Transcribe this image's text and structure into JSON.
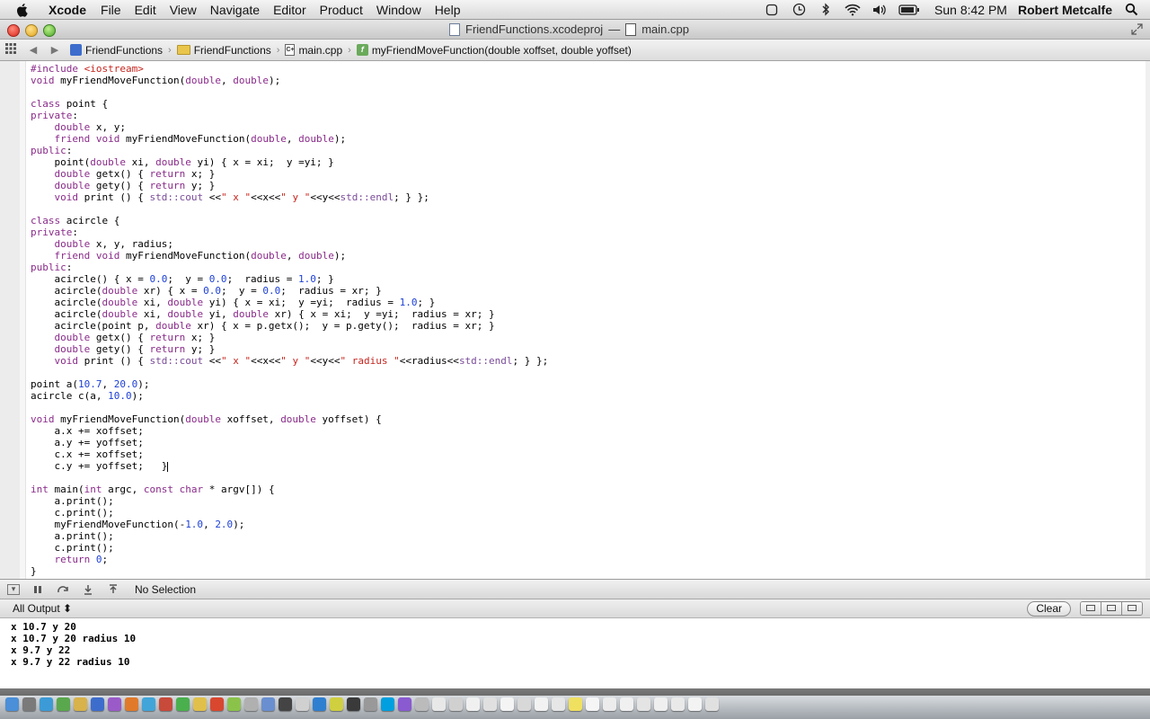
{
  "menubar": {
    "app_name": "Xcode",
    "items": [
      "File",
      "Edit",
      "View",
      "Navigate",
      "Editor",
      "Product",
      "Window",
      "Help"
    ],
    "clock": "Sun 8:42 PM",
    "user": "Robert Metcalfe",
    "status_icons": [
      "cloud-sync-icon",
      "time-machine-icon",
      "bluetooth-icon",
      "wifi-icon",
      "volume-icon",
      "battery-icon"
    ]
  },
  "titlebar": {
    "project": "FriendFunctions.xcodeproj",
    "separator": "—",
    "file": "main.cpp"
  },
  "jumpbar": {
    "crumbs": [
      "FriendFunctions",
      "FriendFunctions",
      "main.cpp",
      "myFriendMoveFunction(double xoffset, double yoffset)"
    ]
  },
  "editor": {
    "language": "C++",
    "lines": [
      "#include <iostream>",
      "void myFriendMoveFunction(double, double);",
      "",
      "class point {",
      "private:",
      "    double x, y;",
      "    friend void myFriendMoveFunction(double, double);",
      "public:",
      "    point(double xi, double yi) { x = xi;  y =yi; }",
      "    double getx() { return x; }",
      "    double gety() { return y; }",
      "    void print () { std::cout <<\" x \"<<x<<\" y \"<<y<<std::endl; } };",
      "",
      "class acircle {",
      "private:",
      "    double x, y, radius;",
      "    friend void myFriendMoveFunction(double, double);",
      "public:",
      "    acircle() { x = 0.0;  y = 0.0;  radius = 1.0; }",
      "    acircle(double xr) { x = 0.0;  y = 0.0;  radius = xr; }",
      "    acircle(double xi, double yi) { x = xi;  y =yi;  radius = 1.0; }",
      "    acircle(double xi, double yi, double xr) { x = xi;  y =yi;  radius = xr; }",
      "    acircle(point p, double xr) { x = p.getx();  y = p.gety();  radius = xr; }",
      "    double getx() { return x; }",
      "    double gety() { return y; }",
      "    void print () { std::cout <<\" x \"<<x<<\" y \"<<y<<\" radius \"<<radius<<std::endl; } };",
      "",
      "point a(10.7, 20.0);",
      "acircle c(a, 10.0);",
      "",
      "void myFriendMoveFunction(double xoffset, double yoffset) {",
      "    a.x += xoffset;",
      "    a.y += yoffset;",
      "    c.x += xoffset;",
      "    c.y += yoffset;   }",
      "",
      "int main(int argc, const char * argv[]) {",
      "    a.print();",
      "    c.print();",
      "    myFriendMoveFunction(-1.0, 2.0);",
      "    a.print();",
      "    c.print();",
      "    return 0;",
      "}"
    ]
  },
  "debugbar": {
    "selection": "No Selection"
  },
  "output": {
    "filter": "All Output ⬍",
    "clear_label": "Clear",
    "lines": [
      "x 10.7 y 20",
      "x 10.7 y 20 radius 10",
      "x 9.7 y 22",
      "x 9.7 y 22 radius 10"
    ]
  },
  "colors": {
    "keyword": "#8a2b8a",
    "string": "#c7251e",
    "number": "#1c3fd6",
    "member": "#3f6e74"
  }
}
